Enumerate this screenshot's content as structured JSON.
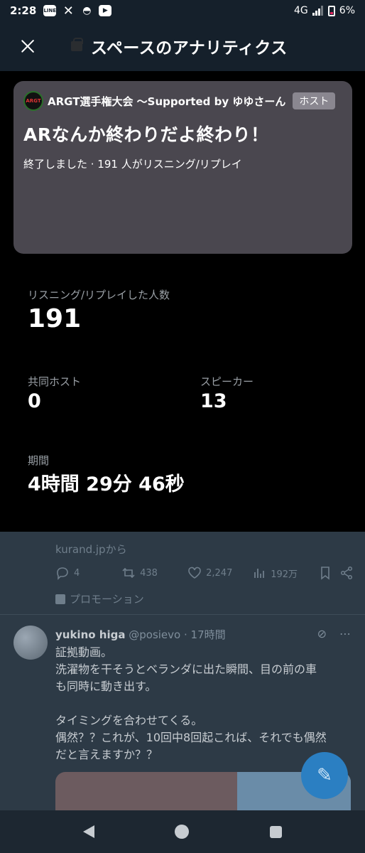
{
  "status_bar": {
    "time": "2:28",
    "network": "4G",
    "battery": "6%",
    "app_icons": [
      "line-icon",
      "x-icon",
      "incognito-icon",
      "youtube-icon"
    ]
  },
  "header": {
    "title": "スペースのアナリティクス"
  },
  "space_card": {
    "avatar_text": "ARGT",
    "space_name": "ARGT選手権大会 〜Supported by ゆゆさーん",
    "host_badge": "ホスト",
    "title": "ARなんか終わりだよ終わり！",
    "status": "終了しました · 191 人がリスニング/リプレイ"
  },
  "stats": {
    "listeners_label": "リスニング/リプレイした人数",
    "listeners_value": "191",
    "cohosts_label": "共同ホスト",
    "cohosts_value": "0",
    "speakers_label": "スピーカー",
    "speakers_value": "13",
    "duration_label": "期間",
    "duration_value": "4時間 29分 46秒"
  },
  "timeline": {
    "source": "kurand.jpから",
    "replies": "4",
    "retweets": "438",
    "likes": "2,247",
    "views": "192万",
    "promotion": "プロモーション",
    "tweet": {
      "name": "yukino higa",
      "handle": "@posievo",
      "time": "· 17時間",
      "lines": [
        "証拠動画。",
        "洗濯物を干そうとベランダに出た瞬間、目の前の車",
        "も同時に動き出す。",
        "",
        "タイミングを合わせてくる。",
        "偶然？？これが、10回中8回起これば、それでも偶然",
        "だと言えますか？？"
      ]
    }
  },
  "colors": {
    "header_bg": "#15202b",
    "card_bg": "#4a474f",
    "timeline_bg": "#2d3a46",
    "fab": "#2b7fc2"
  }
}
